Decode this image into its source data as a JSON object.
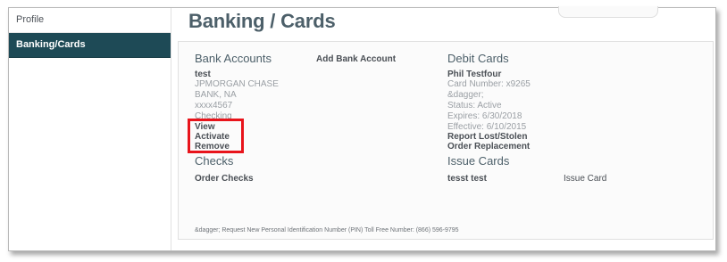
{
  "sidebar": {
    "items": [
      {
        "label": "Profile",
        "active": false
      },
      {
        "label": "Banking/Cards",
        "active": true
      }
    ]
  },
  "page": {
    "title": "Banking / Cards"
  },
  "bank_accounts": {
    "heading": "Bank Accounts",
    "add_label": "Add Bank Account",
    "account": {
      "name": "test",
      "bank_line1": "JPMORGAN CHASE",
      "bank_line2": "BANK, NA",
      "number": "xxxx4567",
      "type": "Checking"
    },
    "actions": {
      "view": "View",
      "activate": "Activate",
      "remove": "Remove"
    }
  },
  "checks": {
    "heading": "Checks",
    "order_label": "Order Checks"
  },
  "debit_cards": {
    "heading": "Debit Cards",
    "card": {
      "holder": "Phil Testfour",
      "number": "Card Number: x9265",
      "dagger": "&dagger;",
      "status": "Status: Active",
      "expires": "Expires: 6/30/2018",
      "effective": "Effective: 6/10/2015"
    },
    "report_label": "Report Lost/Stolen",
    "order_replacement_label": "Order Replacement"
  },
  "issue_cards": {
    "heading": "Issue Cards",
    "name": "tesst test",
    "issue_label": "Issue Card"
  },
  "footer": {
    "note": "&dagger; Request New Personal Identification Number (PIN) Toll Free Number: (866) 596-9795"
  },
  "colors": {
    "sidebar_active": "#1e4a56",
    "highlight": "#e8141b",
    "heading": "#4c5f69"
  }
}
